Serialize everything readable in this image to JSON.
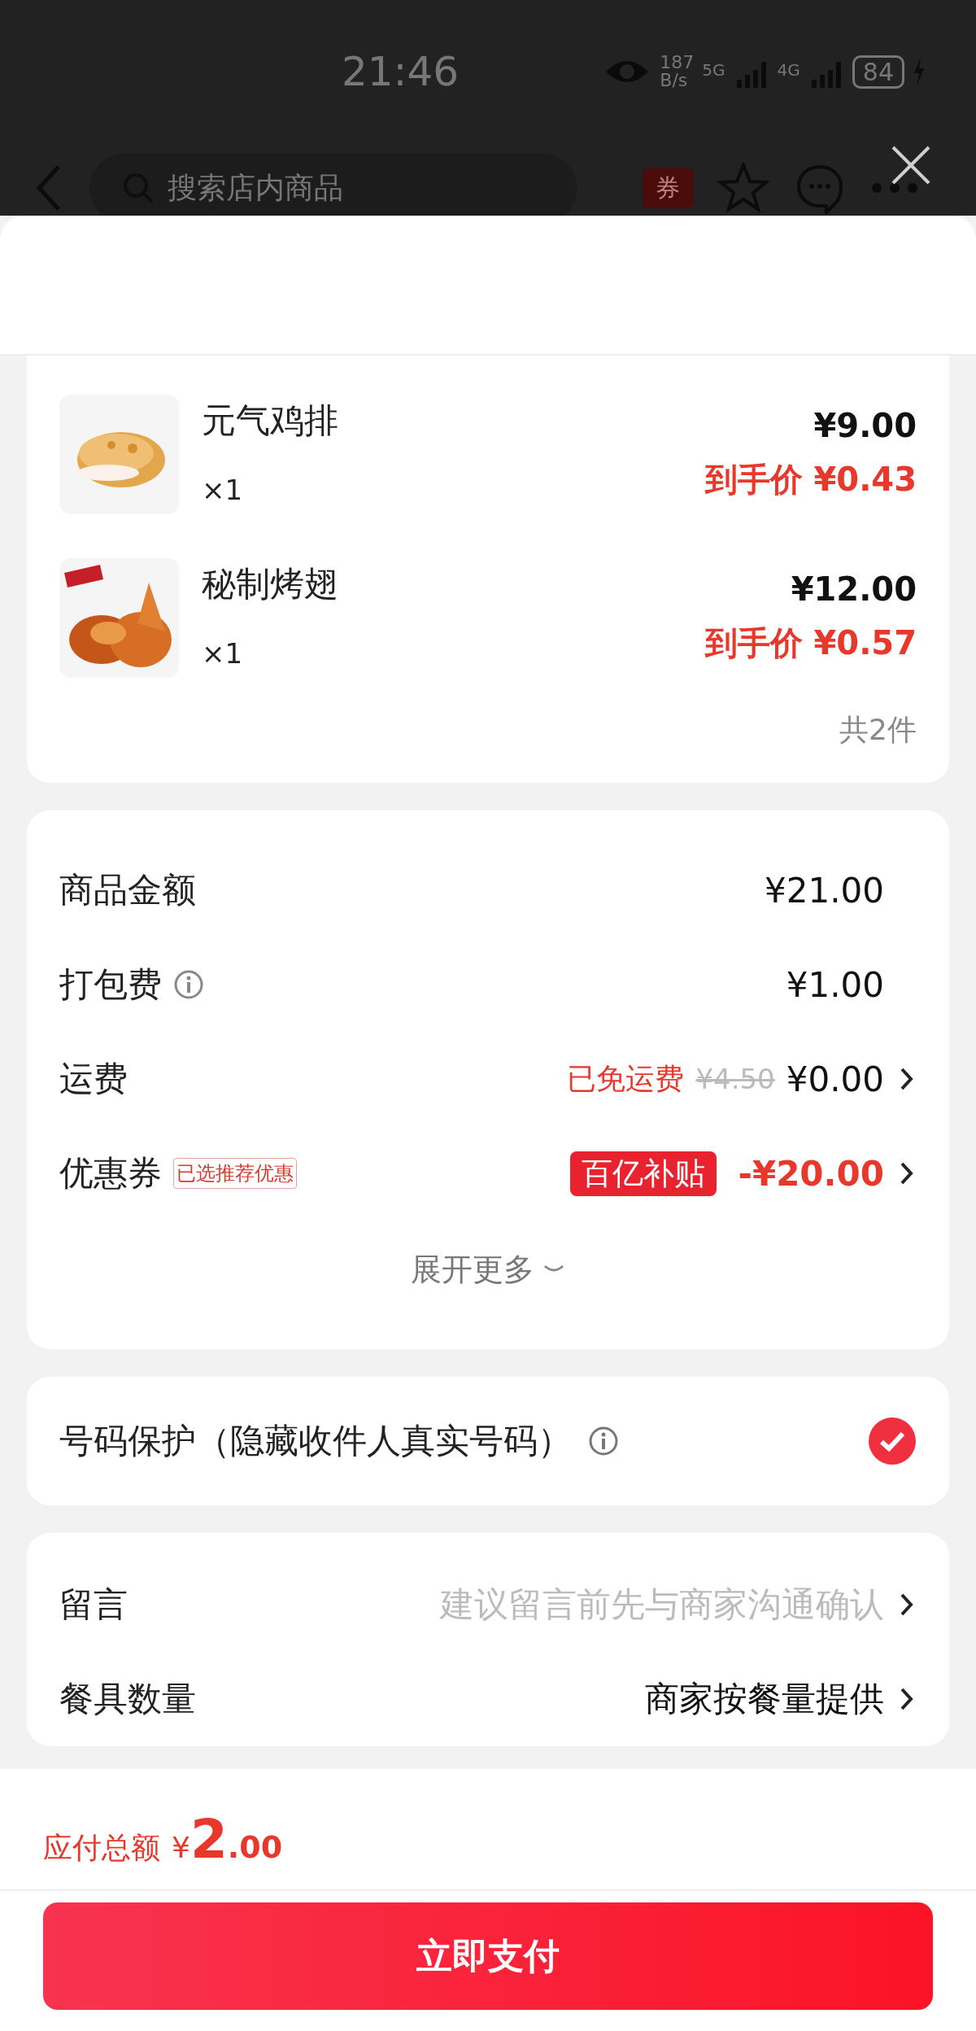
{
  "status_bar": {
    "time": "21:46",
    "speed_value": "187",
    "speed_unit": "B/s",
    "network_1": "5G",
    "network_2": "4G",
    "battery": "84"
  },
  "header": {
    "search_placeholder": "搜索店内商品",
    "coupon_badge": "券"
  },
  "items": [
    {
      "name": "元气鸡排",
      "quantity": "×1",
      "price": "¥9.00",
      "final_label": "到手价",
      "final_price": "¥0.43",
      "kind": "cutlet"
    },
    {
      "name": "秘制烤翅",
      "quantity": "×1",
      "price": "¥12.00",
      "final_label": "到手价",
      "final_price": "¥0.57",
      "kind": "wings"
    }
  ],
  "items_count": "共2件",
  "fees": [
    {
      "kind": "plain",
      "label": "商品金额",
      "value": "¥21.00",
      "arrow": false
    },
    {
      "kind": "info",
      "label": "打包费",
      "value": "¥1.00",
      "arrow": false
    },
    {
      "kind": "delivery",
      "label": "运费",
      "note": "已免运费",
      "original": "¥4.50",
      "value": "¥0.00",
      "arrow": true
    },
    {
      "kind": "coupon",
      "label": "优惠券",
      "tag": "已选推荐优惠",
      "badge": "百亿补贴",
      "value": "-¥20.00",
      "arrow": true
    }
  ],
  "expand_more": "展开更多",
  "privacy": {
    "label": "号码保护（隐藏收件人真实号码）",
    "checked": true
  },
  "options": [
    {
      "label": "留言",
      "placeholder": "建议留言前先与商家沟通确认"
    },
    {
      "label": "餐具数量",
      "value": "商家按餐量提供"
    }
  ],
  "footer": {
    "total_label": "应付总额",
    "currency": "¥",
    "amount_int": "2",
    "amount_dec": ".00",
    "pay_button": "立即支付"
  }
}
